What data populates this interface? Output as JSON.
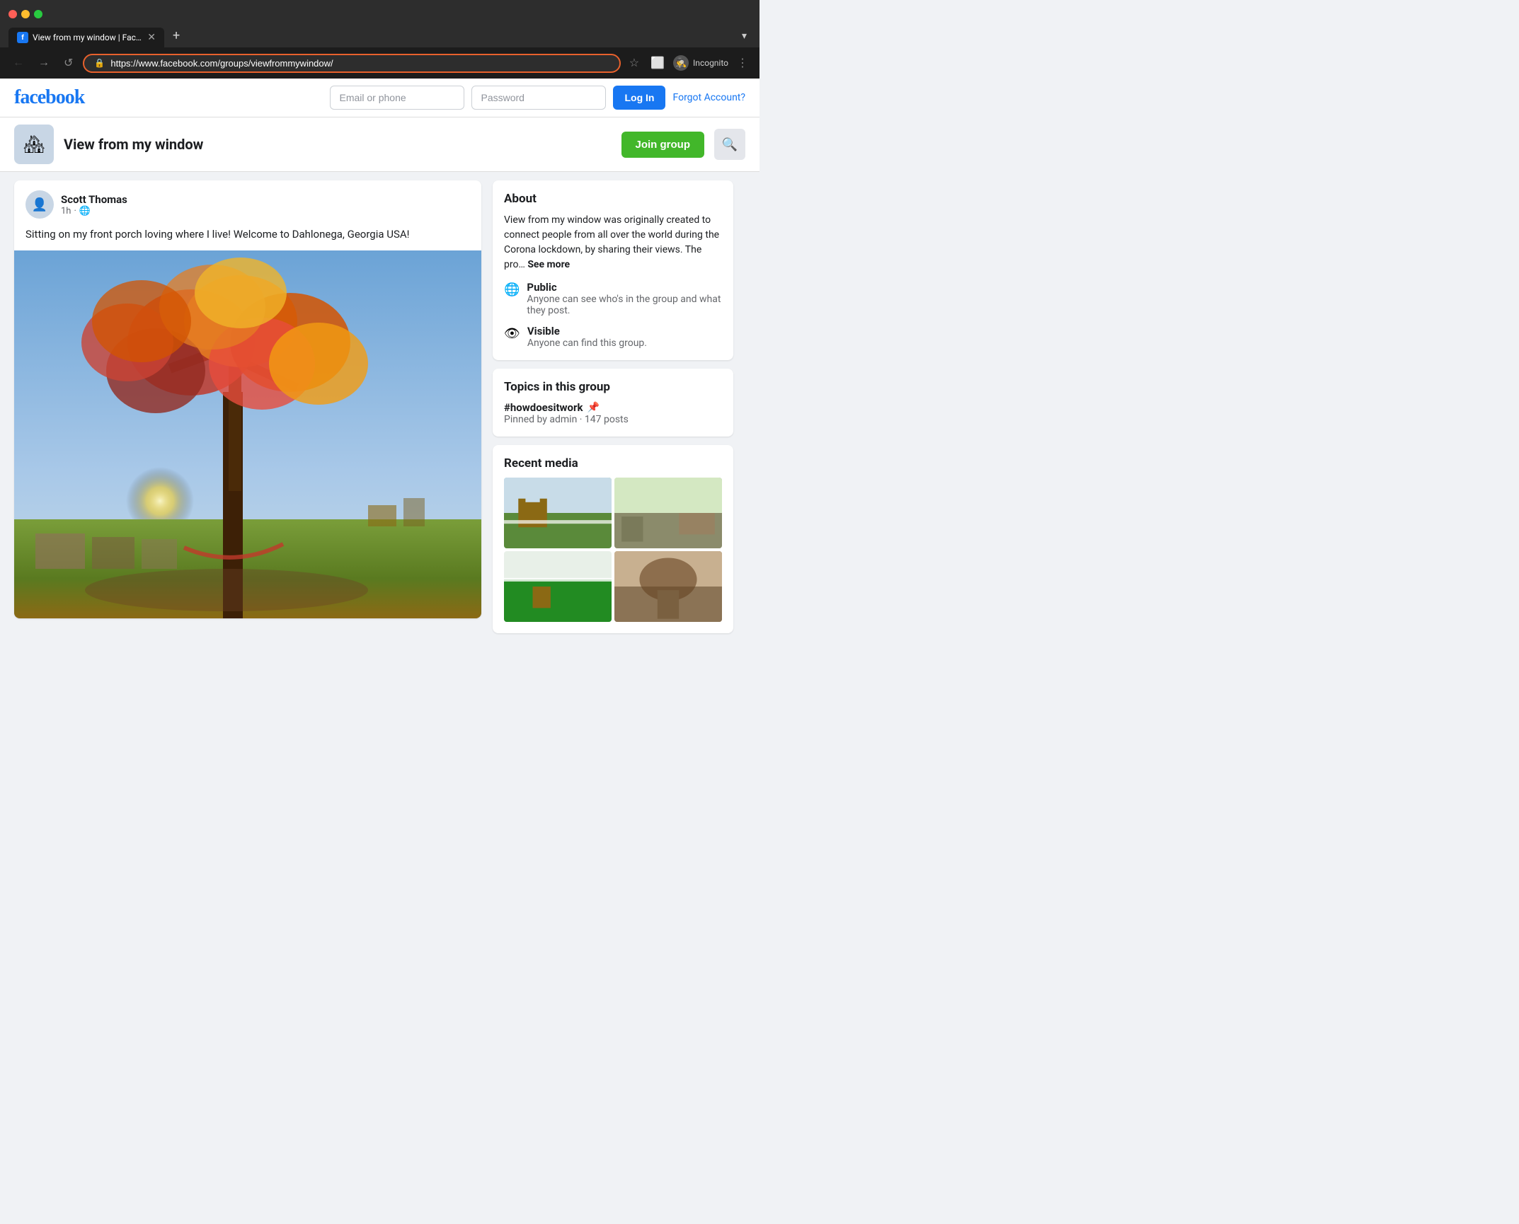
{
  "browser": {
    "tabs": [
      {
        "label": "View from my window | Facebo",
        "active": true,
        "favicon": "f"
      }
    ],
    "new_tab_label": "+",
    "tab_list_label": "▾",
    "url": "https://www.facebook.com/groups/viewfrommywindow/",
    "nav": {
      "back": "←",
      "forward": "→",
      "reload": "↺"
    },
    "toolbar_icons": {
      "star": "☆",
      "split_view": "⬜",
      "incognito": "🕵",
      "incognito_label": "Incognito",
      "menu": "⋮"
    }
  },
  "facebook": {
    "logo": "facebook",
    "header": {
      "email_placeholder": "Email or phone",
      "password_placeholder": "Password",
      "login_button": "Log In",
      "forgot_link": "Forgot Account?"
    },
    "group": {
      "name": "View from my window",
      "join_button": "Join group",
      "search_icon": "🔍"
    },
    "post": {
      "author": "Scott Thomas",
      "time": "1h",
      "privacy": "🌐",
      "text": "Sitting on my front porch loving where I live! Welcome to Dahlonega, Georgia USA!"
    },
    "sidebar": {
      "about_title": "About",
      "about_text": "View from my window was originally created to connect people from all over the world during the Corona lockdown, by sharing their views. The pro…",
      "see_more": "See more",
      "public_title": "Public",
      "public_desc": "Anyone can see who's in the group and what they post.",
      "visible_title": "Visible",
      "visible_desc": "Anyone can find this group.",
      "public_icon": "🌐",
      "visible_icon": "👁",
      "topics_title": "Topics in this group",
      "topic_hashtag": "#howdoesitwork",
      "topic_pin": "📌",
      "topic_meta": "Pinned by admin · 147 posts",
      "recent_media_title": "Recent media"
    }
  }
}
